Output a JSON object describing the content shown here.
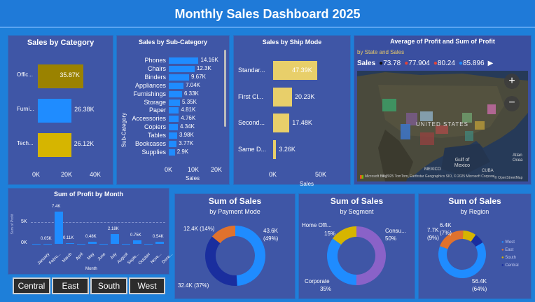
{
  "header": {
    "title": "Monthly Sales Dashboard 2025"
  },
  "colors": {
    "bg": "#1e7fd9",
    "panel": "#3f56a6",
    "blue": "#1f8cff",
    "olive": "#9a8200",
    "gold": "#d6b500",
    "yellow": "#e8cf6a",
    "orange": "#e0722d",
    "navy": "#1a2e9e",
    "purple": "#8a62c8"
  },
  "category": {
    "title": "Sales by Category",
    "items": [
      {
        "label": "Offic...",
        "value_label": "35.87K"
      },
      {
        "label": "Furni...",
        "value_label": "26.38K"
      },
      {
        "label": "Tech...",
        "value_label": "26.12K"
      }
    ],
    "ticks": [
      "0K",
      "20K",
      "40K"
    ]
  },
  "subcategory": {
    "title": "Sales by Sub-Category",
    "ylabel": "Sub-Category",
    "xlabel": "Sales",
    "items": [
      {
        "label": "Phones",
        "value_label": "14.16K"
      },
      {
        "label": "Chairs",
        "value_label": "12.3K"
      },
      {
        "label": "Binders",
        "value_label": "9.67K"
      },
      {
        "label": "Appliances",
        "value_label": "7.04K"
      },
      {
        "label": "Furnishings",
        "value_label": "6.33K"
      },
      {
        "label": "Storage",
        "value_label": "5.35K"
      },
      {
        "label": "Paper",
        "value_label": "4.81K"
      },
      {
        "label": "Accessories",
        "value_label": "4.76K"
      },
      {
        "label": "Copiers",
        "value_label": "4.34K"
      },
      {
        "label": "Tables",
        "value_label": "3.98K"
      },
      {
        "label": "Bookcases",
        "value_label": "3.77K"
      },
      {
        "label": "Supplies",
        "value_label": "2.9K"
      }
    ],
    "ticks": [
      "0K",
      "10K",
      "20K"
    ]
  },
  "shipmode": {
    "title": "Sales by Ship Mode",
    "xlabel": "Sales",
    "items": [
      {
        "label": "Standar...",
        "value_label": "47.39K"
      },
      {
        "label": "First Cl...",
        "value_label": "20.23K"
      },
      {
        "label": "Second...",
        "value_label": "17.48K"
      },
      {
        "label": "Same D...",
        "value_label": "3.26K"
      }
    ],
    "ticks": [
      "0K",
      "50K"
    ]
  },
  "map": {
    "title": "Average of Profit and Sum of Profit",
    "subtitle": "by State and Sales",
    "legend_title": "Sales",
    "legend": [
      {
        "label": "73.78",
        "color": "#111111"
      },
      {
        "label": "77.904",
        "color": "#e0443a"
      },
      {
        "label": "80.24",
        "color": "#e0443a"
      },
      {
        "label": "85.896",
        "color": "#1f8cff"
      }
    ],
    "labels": {
      "country": "UNITED STATES",
      "country2": "MEXICO",
      "gulf": "Gulf of Mexico",
      "cuba": "CUBA",
      "atlantic": "Atlan Ocea",
      "copyright": "© 2025 TomTom, Earthstar Geographics SIO, © 2025 Microsoft Corporation Terms",
      "brand": "Microsoft Bing",
      "source": "© OpenStreetMap"
    }
  },
  "profit_month": {
    "title": "Sum of Profit by Month",
    "xlabel": "Month",
    "ylabel": "Sum of Profit",
    "yticks": [
      "5K",
      "0K"
    ],
    "months": [
      "January",
      "Febru...",
      "March",
      "April",
      "May",
      "June",
      "July",
      "August",
      "Septe...",
      "October",
      "Nove...",
      "Dece..."
    ],
    "value_labels": [
      "",
      "0.05K",
      "7.4K",
      "0.11K",
      "",
      "0.48K",
      "",
      "2.18K",
      "",
      "0.75K",
      "",
      "0.54K"
    ]
  },
  "payment": {
    "title": "Sum of Sales",
    "subtitle": "by Payment Mode",
    "labels": [
      "43.6K\n(49%)",
      "32.4K (37%)",
      "12.4K (14%)"
    ]
  },
  "segment": {
    "title": "Sum of Sales",
    "subtitle": "by Segment",
    "labels": [
      "Consu...",
      "50%",
      "Corporate",
      "35%",
      "Home Offi...",
      "15%"
    ]
  },
  "region": {
    "title": "Sum of Sales",
    "subtitle": "by Region",
    "labels": [
      "56.4K",
      "(64%)",
      "7.7K",
      "(9%)",
      "6.4K",
      "(7%)"
    ],
    "legend": [
      "West",
      "East",
      "South",
      "Central"
    ]
  },
  "slicers": [
    "Central",
    "East",
    "South",
    "West"
  ],
  "chart_data": [
    {
      "type": "bar",
      "title": "Sales by Category",
      "categories": [
        "Offic...",
        "Furni...",
        "Tech..."
      ],
      "values": [
        35870,
        26380,
        26120
      ],
      "xlim": [
        0,
        45000
      ]
    },
    {
      "type": "bar",
      "title": "Sales by Sub-Category",
      "xlabel": "Sales",
      "ylabel": "Sub-Category",
      "categories": [
        "Phones",
        "Chairs",
        "Binders",
        "Appliances",
        "Furnishings",
        "Storage",
        "Paper",
        "Accessories",
        "Copiers",
        "Tables",
        "Bookcases",
        "Supplies"
      ],
      "values": [
        14160,
        12300,
        9670,
        7040,
        6330,
        5350,
        4810,
        4760,
        4340,
        3980,
        3770,
        2900
      ],
      "xlim": [
        0,
        22000
      ]
    },
    {
      "type": "bar",
      "title": "Sales by Ship Mode",
      "xlabel": "Sales",
      "categories": [
        "Standar...",
        "First Cl...",
        "Second...",
        "Same D..."
      ],
      "values": [
        47390,
        20230,
        17480,
        3260
      ],
      "xlim": [
        0,
        75000
      ]
    },
    {
      "type": "bar",
      "title": "Sum of Profit by Month",
      "xlabel": "Month",
      "ylabel": "Sum of Profit",
      "categories": [
        "January",
        "Febru...",
        "March",
        "April",
        "May",
        "June",
        "July",
        "August",
        "Septe...",
        "October",
        "Nove...",
        "Dece..."
      ],
      "values": [
        0,
        50,
        7400,
        110,
        0,
        480,
        0,
        2180,
        0,
        750,
        0,
        540
      ],
      "ylim": [
        0,
        8000
      ]
    },
    {
      "type": "pie",
      "title": "Sum of Sales",
      "subtitle": "by Payment Mode",
      "values": [
        43600,
        32400,
        12400
      ],
      "percent": [
        49,
        37,
        14
      ]
    },
    {
      "type": "pie",
      "title": "Sum of Sales",
      "subtitle": "by Segment",
      "categories": [
        "Consu...",
        "Corporate",
        "Home Offi..."
      ],
      "percent": [
        50,
        35,
        15
      ]
    },
    {
      "type": "pie",
      "title": "Sum of Sales",
      "subtitle": "by Region",
      "categories": [
        "West",
        "East",
        "South",
        "Central"
      ],
      "values": [
        56400,
        17800,
        7700,
        6400
      ],
      "percent": [
        64,
        20,
        9,
        7
      ]
    }
  ]
}
